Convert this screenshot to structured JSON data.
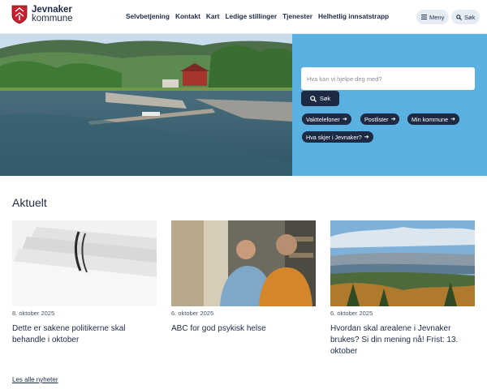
{
  "header": {
    "logo_line1": "Jevnaker",
    "logo_line2": "kommune",
    "nav": [
      "Selvbetjening",
      "Kontakt",
      "Kart",
      "Ledige stillinger",
      "Tjenester",
      "Helhetlig innsatstrapp"
    ],
    "menu_label": "Meny",
    "search_label": "Søk"
  },
  "hero": {
    "search_placeholder": "Hva kan vi hjelpe deg med?",
    "search_button": "Søk",
    "quick_links": [
      "Vakttelefoner",
      "Postlister",
      "Min kommune",
      "Hva skjer i Jevnaker?"
    ],
    "panel_color": "#5ab1e1"
  },
  "news": {
    "title": "Aktuelt",
    "items": [
      {
        "date": "8. oktober 2025",
        "title": "Dette er sakene politikerne skal behandle i oktober"
      },
      {
        "date": "6. oktober 2025",
        "title": "ABC for god psykisk helse"
      },
      {
        "date": "6. oktober 2025",
        "title": "Hvordan skal arealene i Jevnaker brukes? Si din mening nå! Frist: 13. oktober"
      }
    ],
    "all_link": "Les alle nyheter"
  },
  "colors": {
    "navy": "#1d2a44",
    "brand_red": "#c8202f",
    "accent_blue": "#5ab1e1"
  }
}
